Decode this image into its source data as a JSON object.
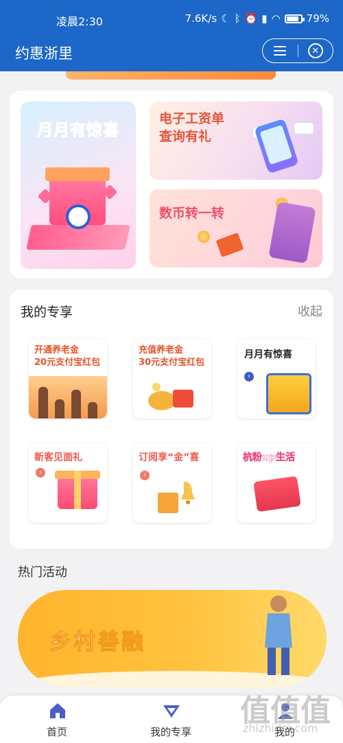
{
  "status_bar": {
    "time": "凌晨2:30",
    "network_speed": "7.6K/s",
    "battery": "79%",
    "icons": [
      "moon-icon",
      "bluetooth-icon",
      "alarm-icon",
      "hd-signal-icon",
      "wifi-icon",
      "battery-icon"
    ]
  },
  "app_bar": {
    "title": "约惠浙里",
    "menu_icon": "menu-icon",
    "close_icon": "close-icon"
  },
  "promo": {
    "big_title": "月月有惊喜",
    "small": [
      {
        "title": "电子工资单\n查询有礼"
      },
      {
        "title": "数币转一转"
      }
    ]
  },
  "exclusive": {
    "title": "我的专享",
    "collapse_label": "收起",
    "tiles": [
      {
        "title": "开通养老金\n20元支付宝红包"
      },
      {
        "title": "充值养老金\n30元支付宝红包"
      },
      {
        "title": "月月有惊喜"
      },
      {
        "title": "新客见面礼"
      },
      {
        "title": "订阅享“金”喜"
      },
      {
        "title": "杭粉up生活"
      }
    ]
  },
  "hot": {
    "title": "热门活动",
    "banner_title": "乡村善融"
  },
  "tab_bar": {
    "tabs": [
      {
        "label": "首页",
        "icon": "home-icon",
        "active": true
      },
      {
        "label": "我的专享",
        "icon": "gift-diamond-icon",
        "active": false
      },
      {
        "label": "我的",
        "icon": "user-icon",
        "active": false
      }
    ]
  },
  "watermark": {
    "glyphs": "值值值",
    "url": "zhizhidai.com"
  },
  "colors": {
    "brand_blue": "#1c67c7",
    "accent_orange": "#ffb42d",
    "tab_icon": "#4a5fc8"
  }
}
